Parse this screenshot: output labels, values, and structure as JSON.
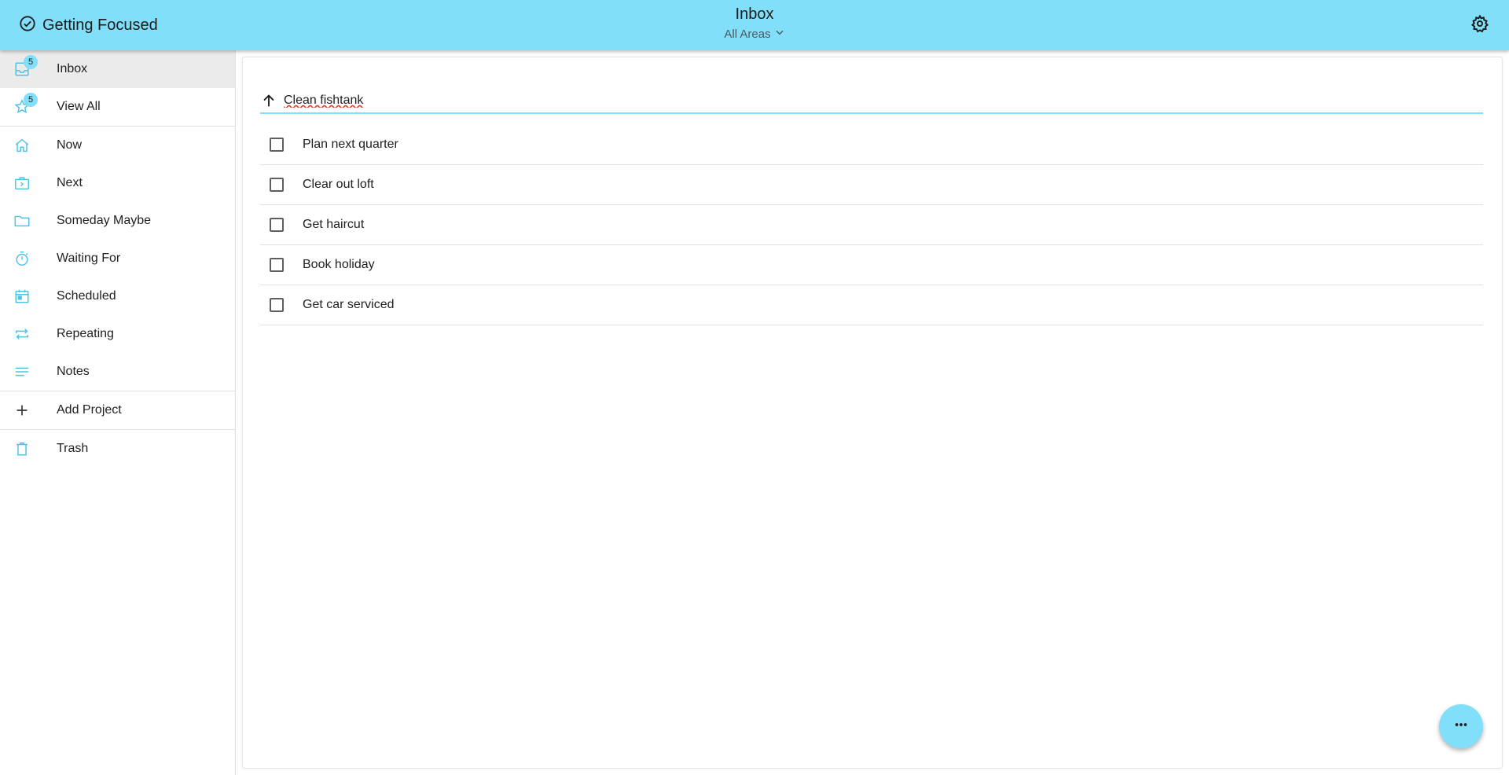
{
  "header": {
    "app_name": "Getting Focused",
    "page_title": "Inbox",
    "area_selector": "All Areas",
    "brand_icon": "check-circle-icon",
    "settings_icon": "gear-icon"
  },
  "sidebar": {
    "items": [
      {
        "label": "Inbox",
        "icon": "inbox-icon",
        "badge": "5",
        "active": true
      },
      {
        "label": "View All",
        "icon": "star-icon",
        "badge": "5"
      },
      {
        "label": "Now",
        "icon": "home-icon"
      },
      {
        "label": "Next",
        "icon": "briefcase-icon"
      },
      {
        "label": "Someday Maybe",
        "icon": "folder-icon"
      },
      {
        "label": "Waiting For",
        "icon": "stopwatch-icon"
      },
      {
        "label": "Scheduled",
        "icon": "calendar-icon"
      },
      {
        "label": "Repeating",
        "icon": "repeat-icon"
      },
      {
        "label": "Notes",
        "icon": "notes-icon"
      },
      {
        "label": "Add Project",
        "icon": "plus-icon"
      },
      {
        "label": "Trash",
        "icon": "trash-icon"
      }
    ]
  },
  "main": {
    "new_item_value": "Clean fishtank",
    "tasks": [
      {
        "label": "Plan next quarter",
        "checked": false
      },
      {
        "label": "Clear out loft",
        "checked": false
      },
      {
        "label": "Get haircut",
        "checked": false
      },
      {
        "label": "Book holiday",
        "checked": false
      },
      {
        "label": "Get car serviced",
        "checked": false
      }
    ]
  },
  "fab": {
    "icon": "more-horizontal-icon"
  },
  "colors": {
    "accent": "#81dffa",
    "icon": "#4fc3e8"
  }
}
